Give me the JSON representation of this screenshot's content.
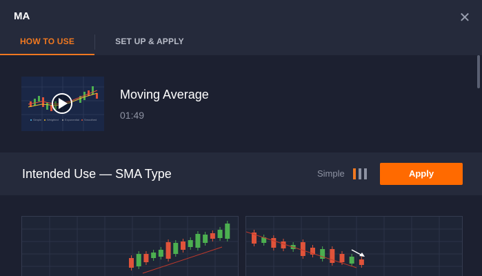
{
  "header": {
    "title": "MA",
    "close_icon": "close-icon"
  },
  "tabs": [
    {
      "label": "HOW TO USE",
      "active": true
    },
    {
      "label": "SET UP & APPLY",
      "active": false
    }
  ],
  "video": {
    "title": "Moving Average",
    "duration": "01:49",
    "play_icon": "play-icon",
    "thumbnail_legend": [
      "Simple",
      "Weighted",
      "Exponential",
      "Smoothed"
    ]
  },
  "intended_use": {
    "title": "Intended Use — SMA Type",
    "type_label": "Simple",
    "type_icon": "bars-icon",
    "apply_label": "Apply"
  },
  "colors": {
    "accent": "#f07820",
    "apply_button": "#ff6a00",
    "bull_candle": "#4caf50",
    "bear_candle": "#e0533a"
  },
  "illustrations": [
    {
      "name": "uptrend-chart",
      "candles": [
        {
          "dir": "down",
          "h": 14
        },
        {
          "dir": "up",
          "h": 18
        },
        {
          "dir": "down",
          "h": 12
        },
        {
          "dir": "up",
          "h": 8
        },
        {
          "dir": "up",
          "h": 10
        },
        {
          "dir": "down",
          "h": 24
        },
        {
          "dir": "up",
          "h": 16
        },
        {
          "dir": "down",
          "h": 12
        },
        {
          "dir": "up",
          "h": 10
        },
        {
          "dir": "up",
          "h": 20
        },
        {
          "dir": "up",
          "h": 12
        },
        {
          "dir": "down",
          "h": 8
        },
        {
          "dir": "up",
          "h": 12
        },
        {
          "dir": "up",
          "h": 22
        }
      ]
    },
    {
      "name": "downtrend-chart",
      "candles": [
        {
          "dir": "down",
          "h": 16
        },
        {
          "dir": "up",
          "h": 8
        },
        {
          "dir": "down",
          "h": 14
        },
        {
          "dir": "down",
          "h": 10
        },
        {
          "dir": "up",
          "h": 6
        },
        {
          "dir": "down",
          "h": 20
        },
        {
          "dir": "down",
          "h": 10
        },
        {
          "dir": "up",
          "h": 14
        },
        {
          "dir": "down",
          "h": 20
        },
        {
          "dir": "down",
          "h": 12
        },
        {
          "dir": "up",
          "h": 10
        },
        {
          "dir": "down",
          "h": 8
        }
      ]
    }
  ]
}
